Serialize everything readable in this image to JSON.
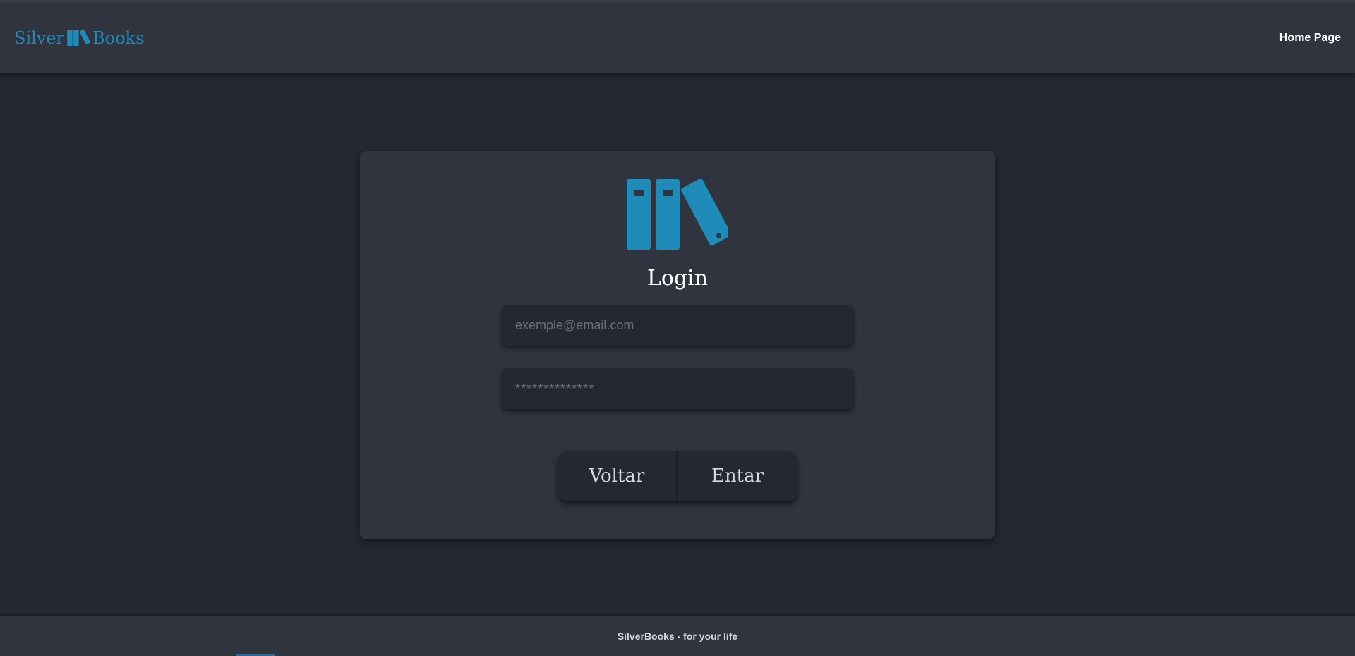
{
  "navbar": {
    "brand_left": "Silver",
    "brand_right": "Books",
    "brand_icon": "books-icon",
    "link": "Home Page"
  },
  "colors": {
    "accent": "#1e8bb8",
    "background": "#252830",
    "surface": "#30343f"
  },
  "login": {
    "logo_icon": "books-icon",
    "title": "Login",
    "email_placeholder": "exemple@email.com",
    "password_placeholder": "**************",
    "back_label": "Voltar",
    "submit_label": "Entar"
  },
  "footer": {
    "text": "SilverBooks - for your life"
  }
}
